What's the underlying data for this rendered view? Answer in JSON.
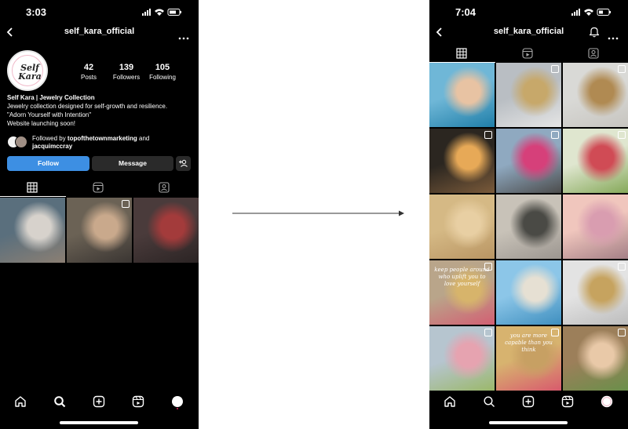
{
  "left_screen": {
    "status": {
      "time": "3:03"
    },
    "nav": {
      "username": "self_kara_official"
    },
    "profile": {
      "avatar_text": "Self Kara",
      "stats": [
        {
          "value": "42",
          "label": "Posts"
        },
        {
          "value": "139",
          "label": "Followers"
        },
        {
          "value": "105",
          "label": "Following"
        }
      ],
      "name": "Self Kara | Jewelry Collection",
      "bio_lines": [
        "Jewelry collection designed for self-growth and resilience.",
        "\"Adorn Yourself with Intention\"",
        "Website launching soon!"
      ],
      "followed_by_prefix": "Followed by ",
      "followed_by_user1": "topofthetownmarketing",
      "followed_by_and": " and",
      "followed_by_user2": "jacquimccray"
    },
    "buttons": {
      "follow": "Follow",
      "message": "Message",
      "add_user": "+&#x2FE;"
    },
    "tiles": [
      {
        "colors": [
          "#5a6f7d",
          "#d7d2cc",
          "#8b7f73"
        ],
        "reel": false
      },
      {
        "colors": [
          "#6b6255",
          "#c9a98c",
          "#3a3532"
        ],
        "reel": true
      },
      {
        "colors": [
          "#4a3b3b",
          "#a33b3b",
          "#2b2424"
        ],
        "reel": false
      }
    ]
  },
  "right_screen": {
    "status": {
      "time": "7:04"
    },
    "nav": {
      "username": "self_kara_official"
    },
    "tiles": [
      {
        "colors": [
          "#6fb7d7",
          "#e8c3a3",
          "#1f7ea8"
        ],
        "reel": false
      },
      {
        "colors": [
          "#b9bec3",
          "#c7a86a",
          "#e5e5e5"
        ],
        "reel": true
      },
      {
        "colors": [
          "#d9d9d6",
          "#b08a52",
          "#c7c5c0"
        ],
        "reel": true
      },
      {
        "colors": [
          "#2b2620",
          "#e7a957",
          "#7a5a3a"
        ],
        "reel": true
      },
      {
        "colors": [
          "#8fa9c0",
          "#d6407a",
          "#4c4c4c"
        ],
        "reel": true
      },
      {
        "colors": [
          "#dfe6cf",
          "#d04b55",
          "#86a95a"
        ],
        "reel": true
      },
      {
        "colors": [
          "#d5b985",
          "#e8cfa3",
          "#b99563"
        ],
        "reel": false
      },
      {
        "colors": [
          "#c8c2b8",
          "#4a4a45",
          "#9c9690"
        ],
        "reel": false
      },
      {
        "colors": [
          "#f0c6bd",
          "#d99db0",
          "#a47f86"
        ],
        "reel": false
      },
      {
        "colors": [
          "#b9a58a",
          "#d7b46b",
          "#d35f73"
        ],
        "reel": true
      },
      {
        "colors": [
          "#8cc6e8",
          "#e6e0d3",
          "#3f8fbf"
        ],
        "reel": false
      },
      {
        "colors": [
          "#e3e3e3",
          "#c6a35f",
          "#bdbdbd"
        ],
        "reel": true
      },
      {
        "colors": [
          "#b6c5cf",
          "#e6a3b0",
          "#9bb86a"
        ],
        "reel": true
      },
      {
        "colors": [
          "#d7b36f",
          "#c7a063",
          "#d85a6d"
        ],
        "reel": true
      },
      {
        "colors": [
          "#9c7f5a",
          "#e9c9a8",
          "#6a8f4a"
        ],
        "reel": true
      }
    ],
    "captions": {
      "tile_9": "keep people around who uplift you to love yourself",
      "tile_13": "you are more capable than you think"
    }
  }
}
